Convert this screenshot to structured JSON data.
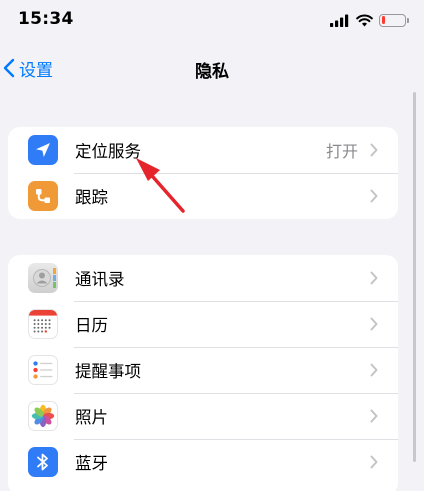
{
  "status_bar": {
    "time": "15:34"
  },
  "nav": {
    "back_label": "设置",
    "title": "隐私"
  },
  "groups": [
    {
      "items": [
        {
          "label": "定位服务",
          "value": "打开",
          "icon": "location-arrow-icon",
          "color": "#2f7cf6"
        },
        {
          "label": "跟踪",
          "icon": "tracking-icon",
          "color": "#f09a37"
        }
      ]
    },
    {
      "items": [
        {
          "label": "通讯录",
          "icon": "contacts-icon"
        },
        {
          "label": "日历",
          "icon": "calendar-icon"
        },
        {
          "label": "提醒事项",
          "icon": "reminders-icon"
        },
        {
          "label": "照片",
          "icon": "photos-icon"
        },
        {
          "label": "蓝牙",
          "icon": "bluetooth-icon",
          "color": "#2f7cf6"
        }
      ]
    }
  ],
  "colors": {
    "accent": "#007aff",
    "annotation_arrow": "#e5242b",
    "battery_low": "#ff3b30"
  }
}
